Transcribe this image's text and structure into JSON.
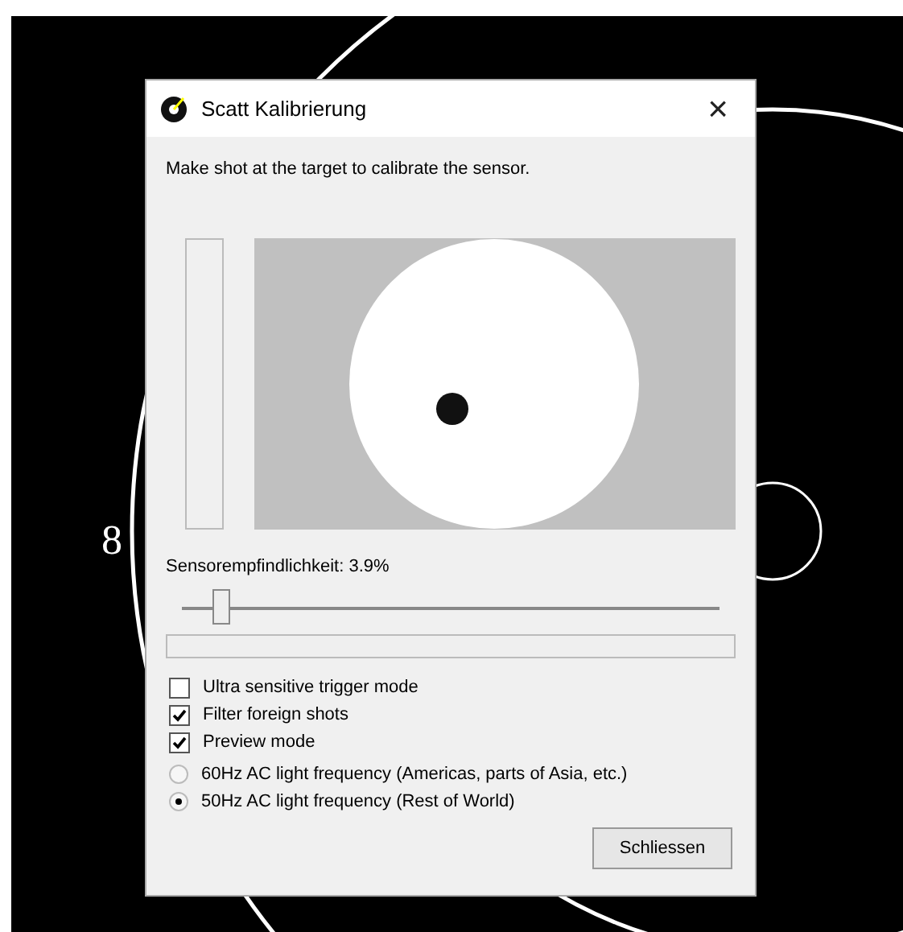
{
  "background": {
    "ring_label": "8"
  },
  "window": {
    "title": "Scatt Kalibrierung",
    "close": "×"
  },
  "instruction": "Make shot at the target to calibrate the sensor.",
  "sensitivity": {
    "label": "Sensorempfindlichkeit: 3.9%",
    "level": 0.05
  },
  "signal": {
    "level": 0
  },
  "options": [
    {
      "kind": "checkbox",
      "label": "Ultra sensitive trigger mode",
      "checked": false
    },
    {
      "kind": "checkbox",
      "label": "Filter foreign shots",
      "checked": true
    },
    {
      "kind": "checkbox",
      "label": "Preview mode",
      "checked": true
    },
    {
      "kind": "radio",
      "label": "60Hz AC light frequency (Americas, parts of Asia, etc.)",
      "selected": false
    },
    {
      "kind": "radio",
      "label": "50Hz AC light frequency (Rest of World)",
      "selected": true
    }
  ],
  "buttons": [
    "Schliessen"
  ]
}
